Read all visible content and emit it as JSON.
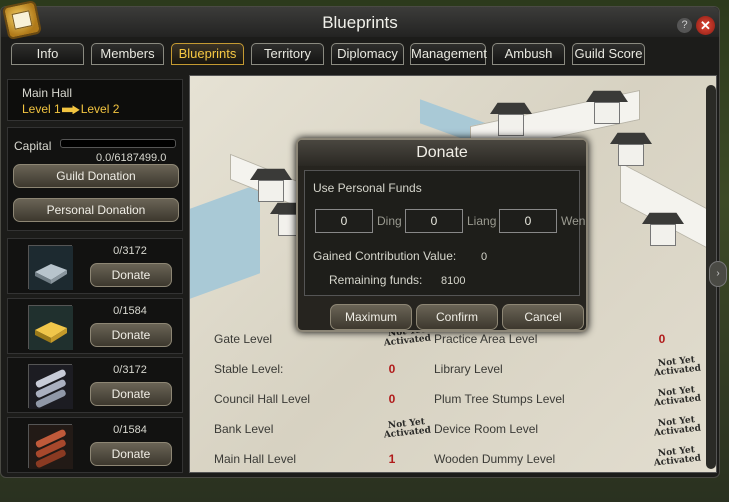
{
  "window": {
    "title": "Blueprints"
  },
  "tabs": [
    {
      "label": "Info"
    },
    {
      "label": "Members"
    },
    {
      "label": "Blueprints"
    },
    {
      "label": "Territory"
    },
    {
      "label": "Diplomacy"
    },
    {
      "label": "Management"
    },
    {
      "label": "Ambush"
    },
    {
      "label": "Guild Score"
    }
  ],
  "active_tab": "Blueprints",
  "main_hall": {
    "title": "Main Hall",
    "from_level": "Level 1",
    "to_level": "Level 2"
  },
  "capital": {
    "label": "Capital",
    "value": "0.0/6187499.0",
    "progress": 0.0
  },
  "buttons": {
    "guild_donation": "Guild Donation",
    "personal_donation": "Personal Donation"
  },
  "items": [
    {
      "icon": "iron-ingot-icon",
      "count": "0/3172",
      "button": "Donate"
    },
    {
      "icon": "gold-ingot-icon",
      "count": "0/1584",
      "button": "Donate"
    },
    {
      "icon": "silver-logs-icon",
      "count": "0/3172",
      "button": "Donate"
    },
    {
      "icon": "wood-logs-icon",
      "count": "0/1584",
      "button": "Donate"
    }
  ],
  "levels": [
    {
      "name": "Gate Level",
      "status": "Not Yet Activated"
    },
    {
      "name": "Stable Level:",
      "status": "0"
    },
    {
      "name": "Council Hall Level",
      "status": "0"
    },
    {
      "name": "Bank Level",
      "status": "Not Yet Activated"
    },
    {
      "name": "Main Hall Level",
      "status": "1"
    },
    {
      "name": "Practice Area Level",
      "status": "0"
    },
    {
      "name": "Library Level",
      "status": "Not Yet Activated"
    },
    {
      "name": "Plum Tree Stumps Level",
      "status": "Not Yet Activated"
    },
    {
      "name": "Device Room Level",
      "status": "Not Yet Activated"
    },
    {
      "name": "Wooden Dummy Level",
      "status": "Not Yet Activated"
    }
  ],
  "dialog": {
    "title": "Donate",
    "section": "Use Personal Funds",
    "inputs": [
      {
        "value": "0",
        "unit": "Ding"
      },
      {
        "value": "0",
        "unit": "Liang"
      },
      {
        "value": "0",
        "unit": "Wen"
      }
    ],
    "gained_label": "Gained Contribution Value:",
    "gained_value": "0",
    "remaining_label": "Remaining funds:",
    "remaining_value": "8100",
    "buttons": {
      "maximum": "Maximum",
      "confirm": "Confirm",
      "cancel": "Cancel"
    }
  },
  "colors": {
    "accent": "#f2c440",
    "status_red": "#b01a1a"
  }
}
